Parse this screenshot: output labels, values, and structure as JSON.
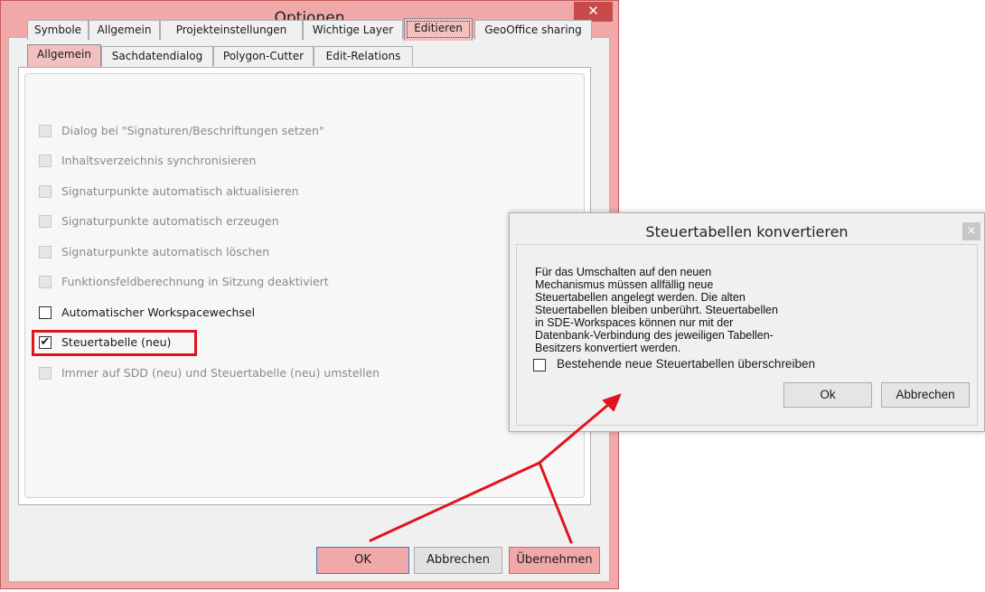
{
  "window": {
    "title": "Optionen",
    "close_glyph": "✕"
  },
  "tabs_top": [
    {
      "label": "Symbole"
    },
    {
      "label": "Allgemein"
    },
    {
      "label": "Projekteinstellungen"
    },
    {
      "label": "Wichtige Layer"
    },
    {
      "label": "Editieren",
      "selected": true
    },
    {
      "label": "GeoOffice sharing"
    }
  ],
  "tabs_sub": [
    {
      "label": "Allgemein",
      "selected": true
    },
    {
      "label": "Sachdatendialog"
    },
    {
      "label": "Polygon-Cutter"
    },
    {
      "label": "Edit-Relations"
    }
  ],
  "options": [
    {
      "label": "Dialog bei \"Signaturen/Beschriftungen setzen\"",
      "checked": false,
      "enabled": false
    },
    {
      "label": "Inhaltsverzeichnis synchronisieren",
      "checked": false,
      "enabled": false
    },
    {
      "label": "Signaturpunkte automatisch aktualisieren",
      "checked": false,
      "enabled": false
    },
    {
      "label": "Signaturpunkte automatisch erzeugen",
      "checked": false,
      "enabled": false
    },
    {
      "label": "Signaturpunkte automatisch löschen",
      "checked": false,
      "enabled": false
    },
    {
      "label": "Funktionsfeldberechnung in Sitzung deaktiviert",
      "checked": false,
      "enabled": false
    },
    {
      "label": "Automatischer Workspacewechsel",
      "checked": false,
      "enabled": true
    },
    {
      "label": "Steuertabelle (neu)",
      "checked": true,
      "enabled": true
    },
    {
      "label": "Immer auf SDD (neu) und Steuertabelle (neu) umstellen",
      "checked": false,
      "enabled": false
    }
  ],
  "buttons": {
    "ok": "OK",
    "cancel": "Abbrechen",
    "apply": "Übernehmen"
  },
  "dialog": {
    "title": "Steuertabellen konvertieren",
    "close_glyph": "×",
    "message": "Für das Umschalten auf den neuen Mechanismus müssen allfällig neue Steuertabellen angelegt werden. Die alten Steuertabellen bleiben unberührt. Steuertabellen in SDE-Workspaces können nur mit der Datenbank-Verbindung des jeweiligen Tabellen-Besitzers konvertiert werden.",
    "checkbox_label": "Bestehende neue Steuertabellen überschreiben",
    "checkbox_checked": false,
    "ok": "Ok",
    "cancel": "Abbrechen"
  },
  "colors": {
    "highlight": "#f0a8a8",
    "annotation_red": "#e0141c"
  },
  "icons": {
    "checkmark": "✔"
  }
}
